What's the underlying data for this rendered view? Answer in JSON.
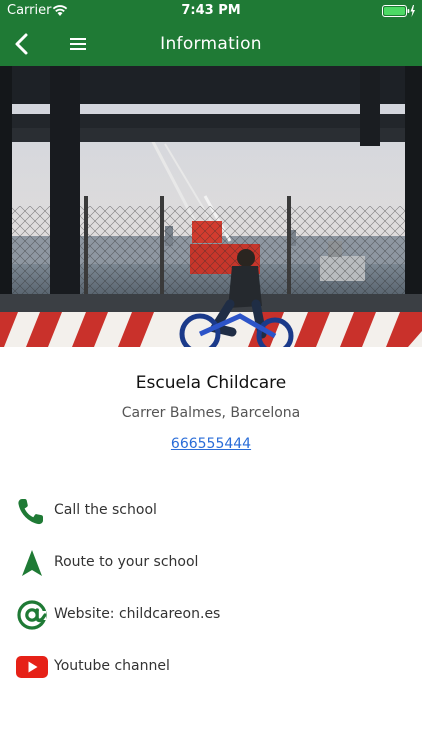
{
  "status_bar": {
    "carrier": "Carrier",
    "time": "7:43 PM",
    "wifi_icon": "wifi-icon",
    "battery_icon": "battery-charging-icon"
  },
  "nav": {
    "title": "Information",
    "back_icon": "chevron-left-icon",
    "menu_icon": "hamburger-menu-icon"
  },
  "hero": {
    "image": "photo-harbor-cyclist"
  },
  "school": {
    "name": "Escuela Childcare",
    "address": "Carrer Balmes, Barcelona",
    "phone": "666555444"
  },
  "actions": [
    {
      "label": "Call the school",
      "icon": "phone-icon"
    },
    {
      "label": "Route to your school",
      "icon": "navigation-arrow-icon"
    },
    {
      "label": "Website: childcareon.es",
      "icon": "at-sign-icon"
    },
    {
      "label": "Youtube channel",
      "icon": "youtube-icon"
    }
  ],
  "colors": {
    "brand_green": "#1f7a35",
    "link_blue": "#2a6dd8",
    "youtube_red": "#e62117"
  }
}
